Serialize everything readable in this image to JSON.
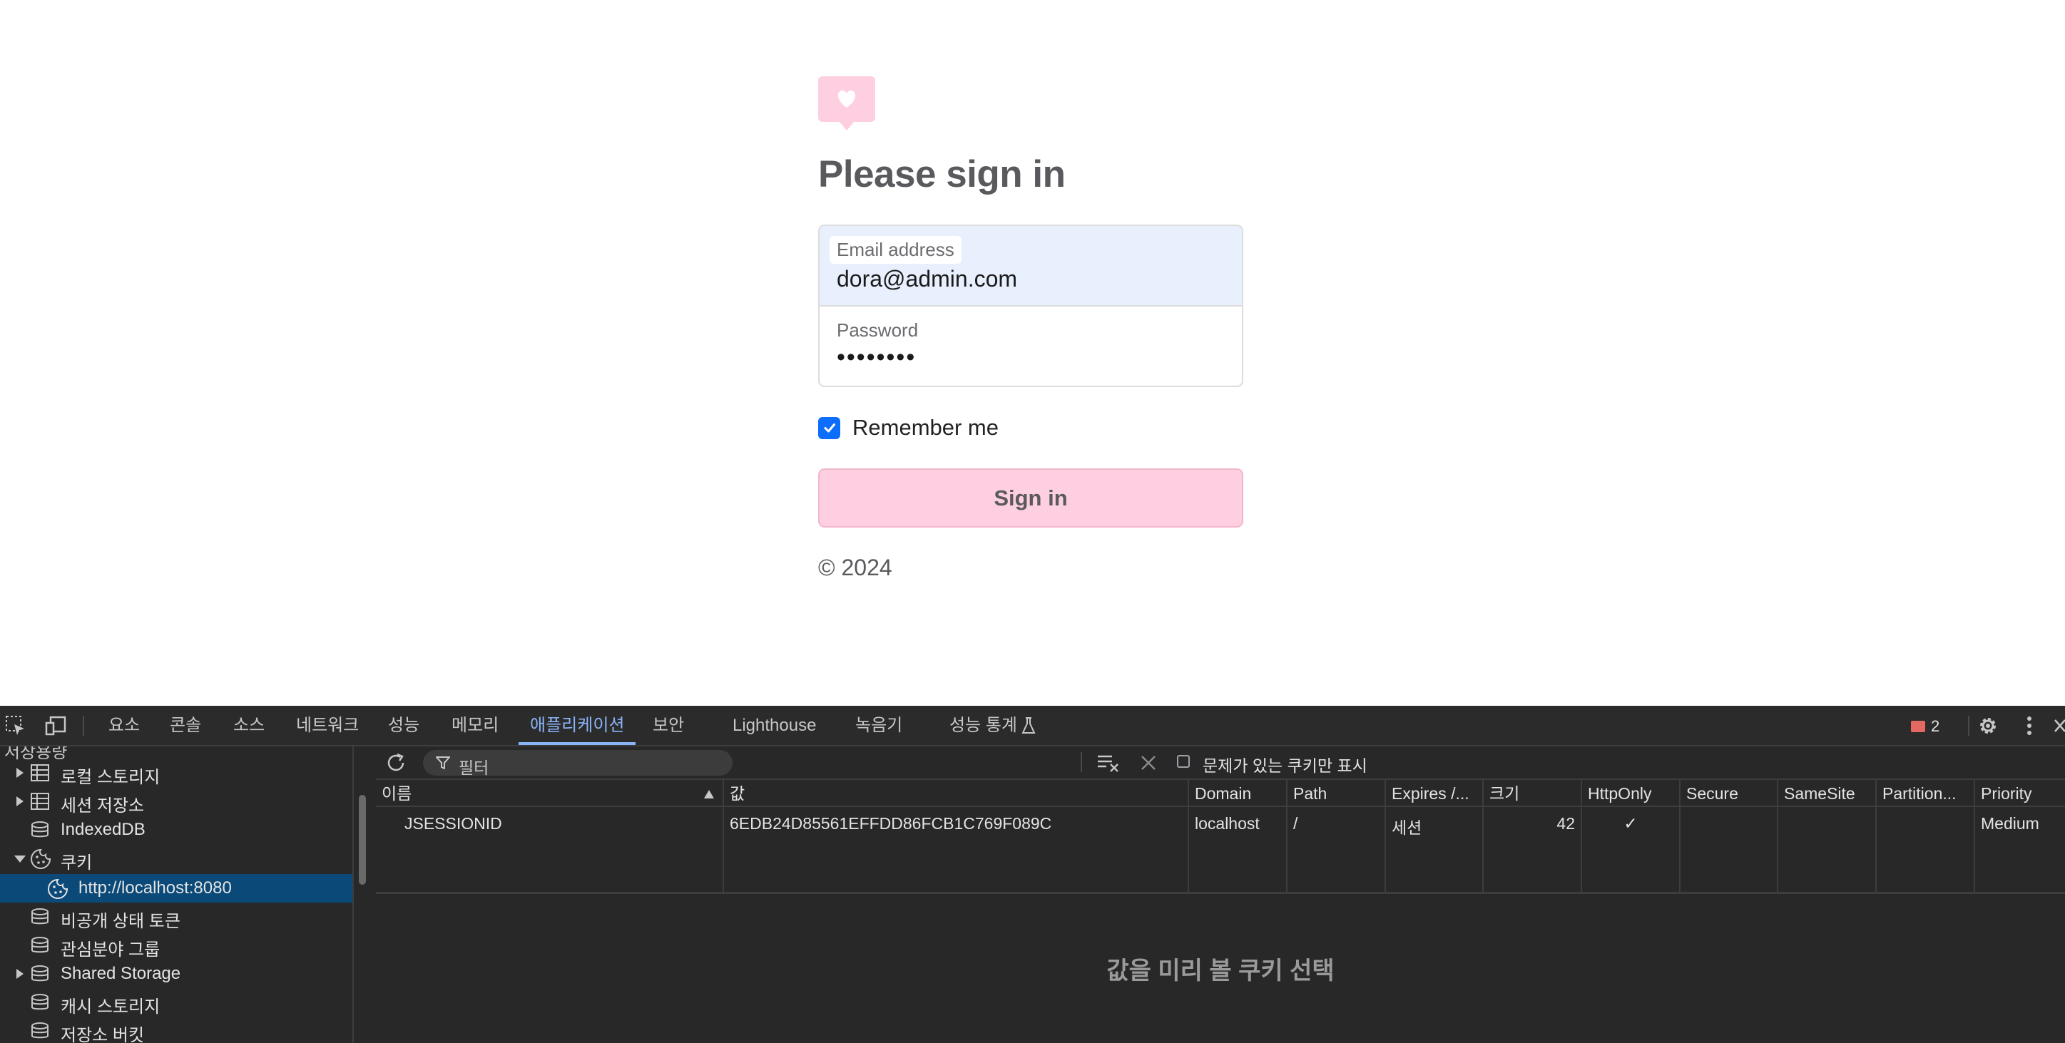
{
  "login": {
    "title": "Please sign in",
    "email_label": "Email address",
    "email_value": "dora@admin.com",
    "password_label": "Password",
    "password_value": "••••••••",
    "remember_label": "Remember me",
    "remember_checked": true,
    "signin_label": "Sign in",
    "copyright": "© 2024",
    "brand_color": "#fecfe0",
    "logo_icon": "heart-chat-icon"
  },
  "devtools": {
    "tabs": [
      "요소",
      "콘솔",
      "소스",
      "네트워크",
      "성능",
      "메모리",
      "애플리케이션",
      "보안",
      "Lighthouse",
      "녹음기",
      "성능 통계"
    ],
    "active_tab": "애플리케이션",
    "issue_count": "2",
    "sidebar": {
      "clipped_header": "저장용량",
      "items": [
        {
          "label": "로컬 스토리지",
          "icon": "table-icon",
          "expandable": true
        },
        {
          "label": "세션 저장소",
          "icon": "table-icon",
          "expandable": true
        },
        {
          "label": "IndexedDB",
          "icon": "database-icon",
          "expandable": false
        },
        {
          "label": "쿠키",
          "icon": "cookie-icon",
          "expandable": true,
          "expanded": true
        },
        {
          "label": "http://localhost:8080",
          "icon": "cookie-icon",
          "selected": true
        },
        {
          "label": "비공개 상태 토큰",
          "icon": "database-icon"
        },
        {
          "label": "관심분야 그룹",
          "icon": "database-icon"
        },
        {
          "label": "Shared Storage",
          "icon": "database-icon",
          "expandable": true
        },
        {
          "label": "캐시 스토리지",
          "icon": "database-icon"
        },
        {
          "label": "저장소 버킷",
          "icon": "database-icon"
        }
      ]
    },
    "toolbar": {
      "filter_placeholder": "필터",
      "issues_only_label": "문제가 있는 쿠키만 표시"
    },
    "cookie_table": {
      "columns": [
        "이름",
        "값",
        "Domain",
        "Path",
        "Expires /...",
        "크기",
        "HttpOnly",
        "Secure",
        "SameSite",
        "Partition...",
        "Priority"
      ],
      "rows": [
        {
          "name": "JSESSIONID",
          "value": "6EDB24D85561EFFDD86FCB1C769F089C",
          "domain": "localhost",
          "path": "/",
          "expires": "세션",
          "size": "42",
          "httponly": "✓",
          "secure": "",
          "samesite": "",
          "partition": "",
          "priority": "Medium"
        }
      ]
    },
    "preview_placeholder": "값을 미리 볼 쿠키 선택"
  }
}
